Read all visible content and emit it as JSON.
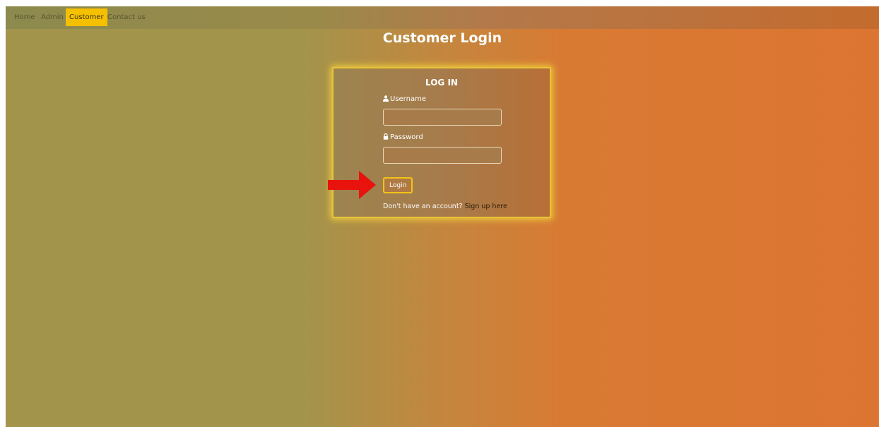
{
  "nav": {
    "items": [
      {
        "label": "Home",
        "active": false
      },
      {
        "label": "Admin",
        "active": false
      },
      {
        "label": "Customer",
        "active": true
      },
      {
        "label": "Contact us",
        "active": false
      }
    ]
  },
  "page": {
    "title": "Customer Login"
  },
  "login_card": {
    "heading": "LOG IN",
    "username_label": "Username",
    "username_value": "",
    "password_label": "Password",
    "password_value": "",
    "submit_label": "Login",
    "signup_prompt": "Don't have an account?",
    "signup_link": "Sign up here"
  },
  "annotation": {
    "arrow_icon": "red-arrow-right-icon",
    "arrow_color": "#e8130d"
  },
  "colors": {
    "accent": "#f5c000",
    "card_border": "#e8c23a"
  }
}
